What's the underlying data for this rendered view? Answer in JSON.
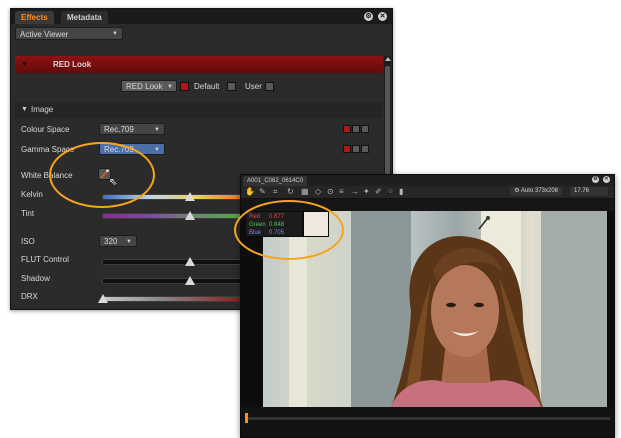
{
  "effects": {
    "tabs": [
      {
        "label": "Effects",
        "active": true
      },
      {
        "label": "Metadata",
        "active": false
      }
    ],
    "viewer_select": "Active Viewer",
    "red_look_header": "RED Look",
    "look_select": "RED Look",
    "default_label": "Default",
    "user_label": "User",
    "image_section": "Image",
    "rows": {
      "colour_space": {
        "label": "Colour Space",
        "value": "Rec.709"
      },
      "gamma_space": {
        "label": "Gamma Space",
        "value": "Rec.709"
      },
      "white_balance": {
        "label": "White Balance"
      },
      "kelvin": {
        "label": "Kelvin",
        "level": 0.62
      },
      "tint": {
        "label": "Tint",
        "level": 0.62
      },
      "iso": {
        "label": "ISO",
        "value": "320"
      },
      "flut": {
        "label": "FLUT Control",
        "level": 0.62
      },
      "shadow": {
        "label": "Shadow",
        "level": 0.62
      },
      "drx": {
        "label": "DRX",
        "level": 0.0
      }
    }
  },
  "viewer": {
    "tab": "A001_C062_0614C0",
    "zoom": "Auto 373x208",
    "fps": "17.76",
    "readout": {
      "red_label": "Red",
      "red_value": "0.877",
      "green_label": "Green",
      "green_value": "0.848",
      "blue_label": "Blue",
      "blue_value": "0.705"
    },
    "swatch_color": "#efe9dd"
  },
  "colors": {
    "accent": "#ff8c1a",
    "annotation": "#f4a51b",
    "header_red": "#8e1212"
  }
}
